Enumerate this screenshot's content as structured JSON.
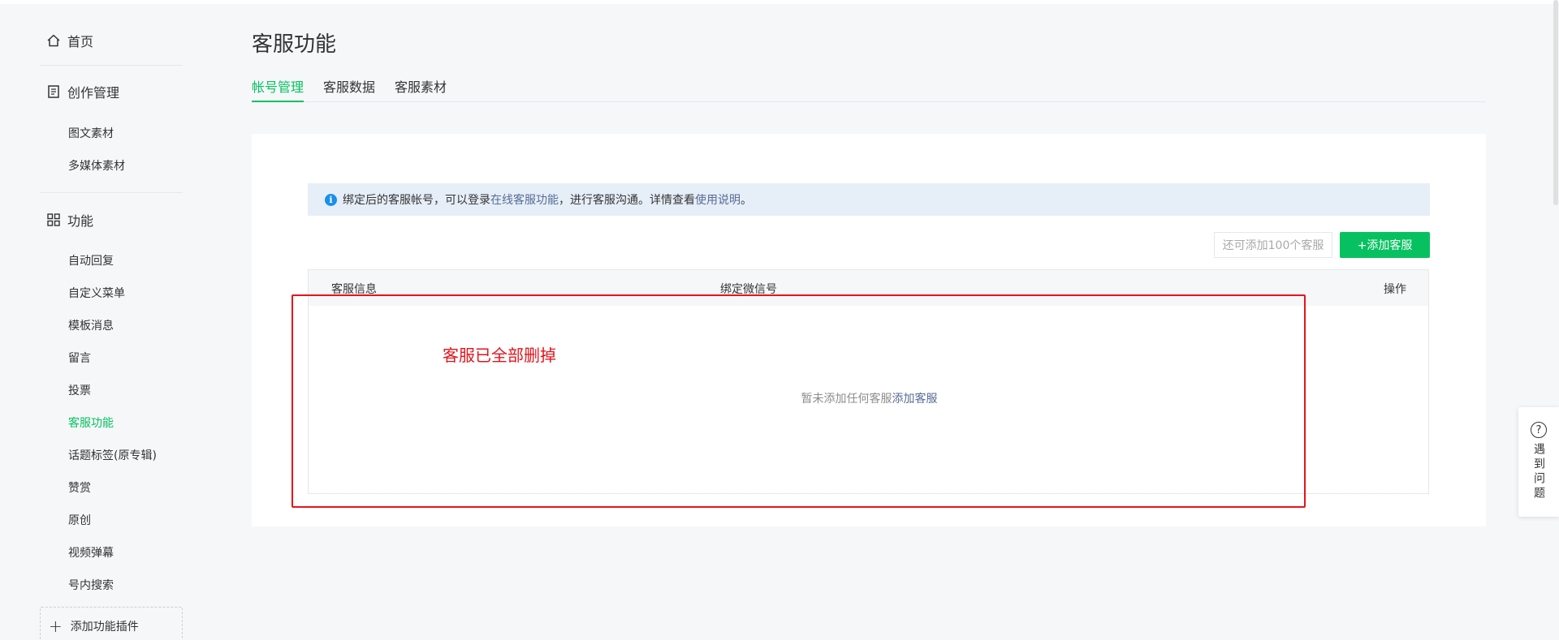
{
  "sidebar": {
    "home": "首页",
    "sections": [
      {
        "title": "创作管理",
        "icon": "document-icon",
        "items": [
          "图文素材",
          "多媒体素材"
        ]
      },
      {
        "title": "功能",
        "icon": "grid-icon",
        "items": [
          "自动回复",
          "自定义菜单",
          "模板消息",
          "留言",
          "投票",
          "客服功能",
          "话题标签(原专辑)",
          "赞赏",
          "原创",
          "视频弹幕",
          "号内搜索"
        ]
      }
    ],
    "active_item": "客服功能",
    "add_plugin": "添加功能插件"
  },
  "page": {
    "title": "客服功能",
    "tabs": [
      "帐号管理",
      "客服数据",
      "客服素材"
    ],
    "active_tab": "帐号管理"
  },
  "notice": {
    "text1": "绑定后的客服帐号，可以登录",
    "link1": "在线客服功能",
    "text2": "，进行客服沟通。详情查看",
    "link2": "使用说明",
    "text3": "。"
  },
  "toolbar": {
    "quota": "还可添加100个客服",
    "add_button": "+添加客服"
  },
  "table": {
    "headers": [
      "客服信息",
      "绑定微信号",
      "操作"
    ],
    "empty_text": "暂未添加任何客服",
    "empty_link": "添加客服"
  },
  "annotation": {
    "text": "客服已全部删掉",
    "color": "#e5141b"
  },
  "help": {
    "text": "遇到问题"
  },
  "colors": {
    "accent": "#07c160",
    "link": "#576b95"
  }
}
